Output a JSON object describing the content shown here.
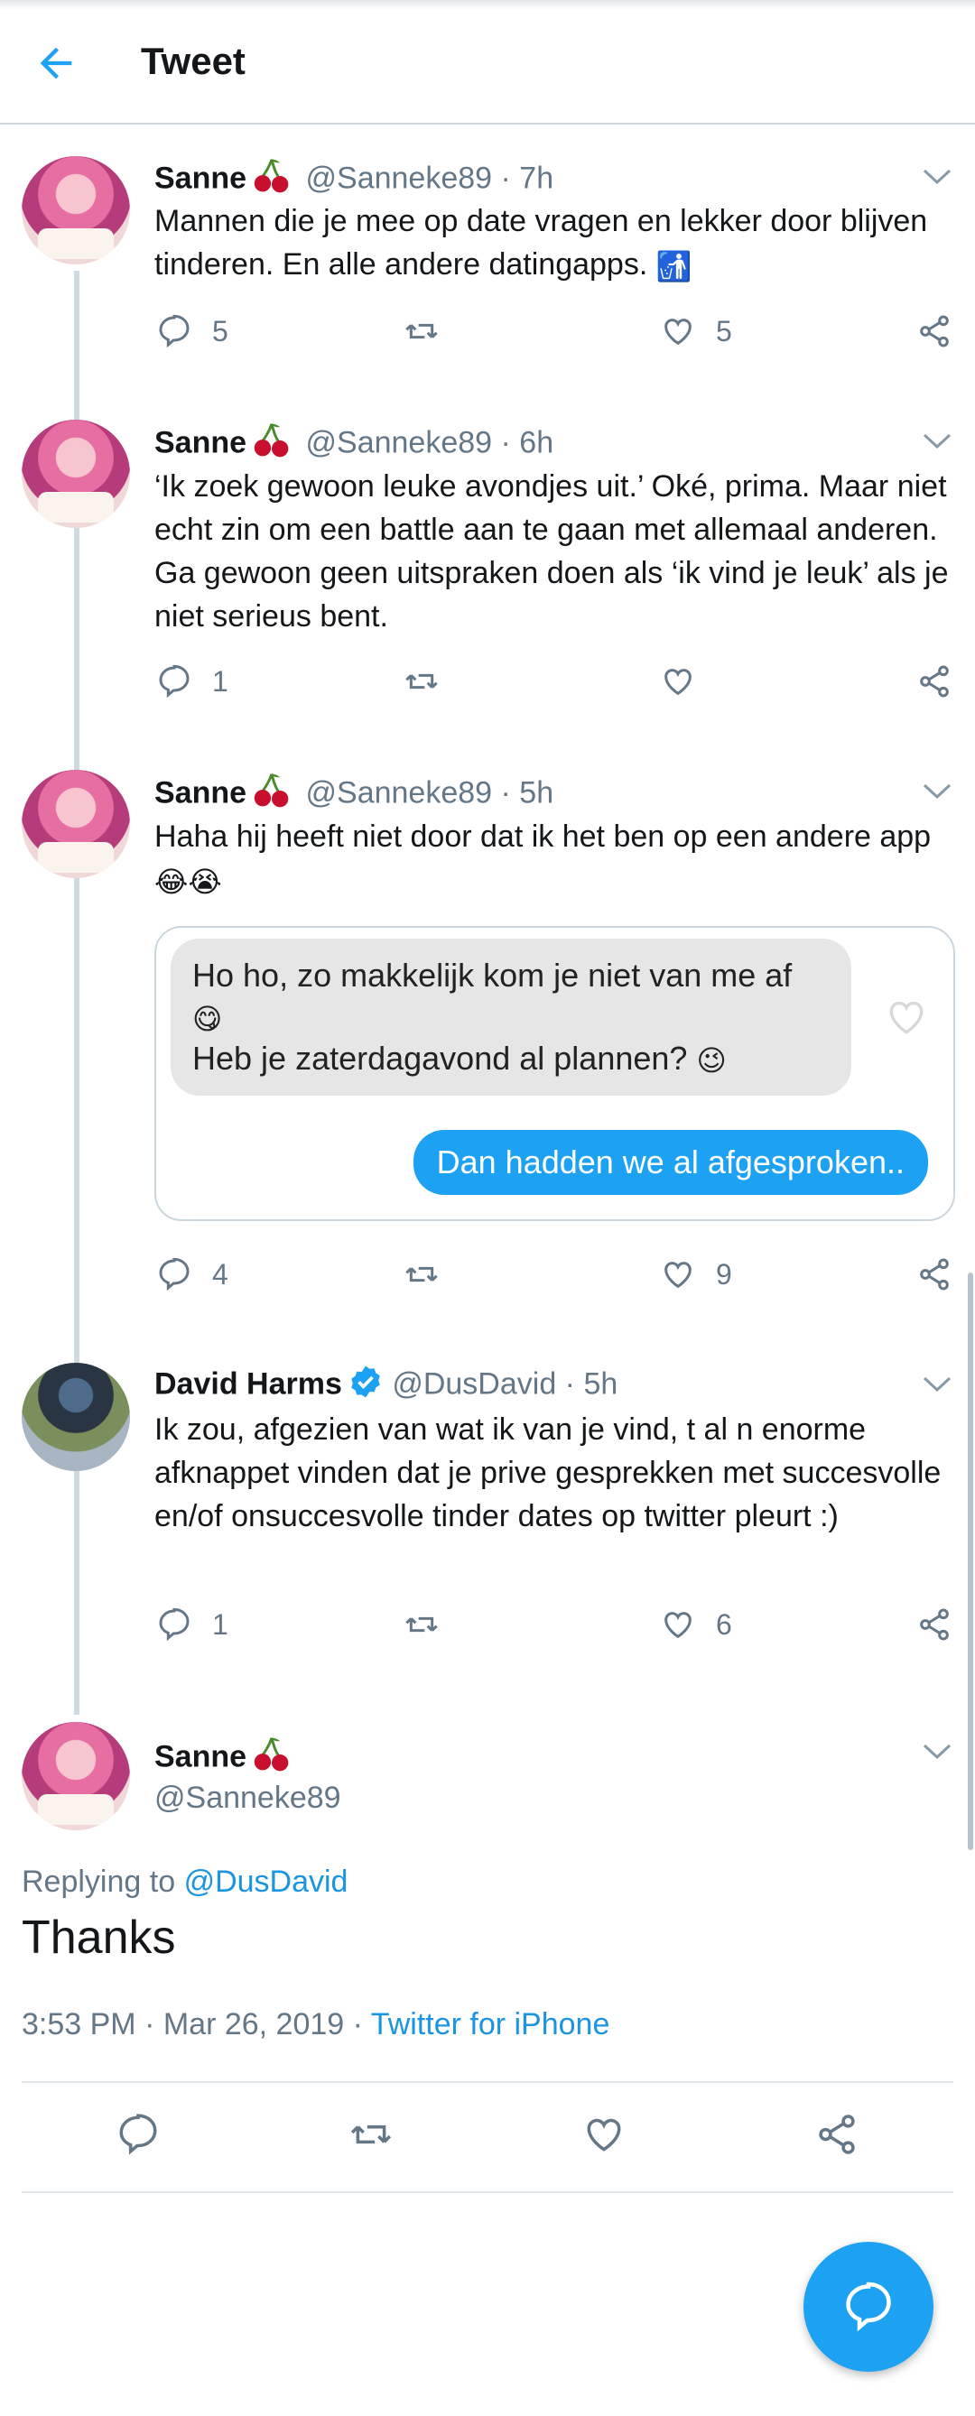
{
  "header": {
    "title": "Tweet",
    "back_icon": "back-arrow-icon"
  },
  "colors": {
    "accent": "#1da1f2",
    "link": "#1b95e0",
    "muted": "#657786",
    "text": "#14171a"
  },
  "thread": [
    {
      "name": "Sanne",
      "handle": "@Sanneke89",
      "time": "7h",
      "text": "Mannen die je mee op date vragen en lekker door blijven tinderen. En alle andere datingapps.",
      "emoji": "🚮",
      "replies": "5",
      "retweets": "",
      "likes": "5"
    },
    {
      "name": "Sanne",
      "handle": "@Sanneke89",
      "time": "6h",
      "text": "‘Ik zoek gewoon leuke avondjes uit.’ Oké, prima. Maar niet echt zin om een battle aan te gaan met allemaal anderen. Ga gewoon geen uitspraken doen als ‘ik vind je leuk’ als je niet serieus bent.",
      "replies": "1",
      "retweets": "",
      "likes": ""
    },
    {
      "name": "Sanne",
      "handle": "@Sanneke89",
      "time": "5h",
      "text": "Haha hij heeft niet door dat ik het ben op een andere app",
      "emoji": "😂😭",
      "media": {
        "incoming_line1": "Ho ho, zo makkelijk kom je niet van me af",
        "incoming_emoji1": "😋",
        "incoming_line2": "Heb je zaterdagavond al plannen?",
        "incoming_emoji2": "😉",
        "outgoing": "Dan hadden we al afgesproken.."
      },
      "replies": "4",
      "retweets": "",
      "likes": "9"
    },
    {
      "name": "David Harms",
      "handle": "@DusDavid",
      "time": "5h",
      "verified": true,
      "text": "Ik zou, afgezien van wat ik van je vind, t al n enorme afknappet vinden dat je prive gesprekken met succesvolle en/of onsuccesvolle tinder dates op twitter pleurt :)",
      "replies": "1",
      "retweets": "",
      "likes": "6"
    }
  ],
  "main": {
    "name": "Sanne",
    "handle": "@Sanneke89",
    "replying_prefix": "Replying to",
    "replying_handle": "@DusDavid",
    "text": "Thanks",
    "timestamp": "3:53 PM · Mar 26, 2019 · ",
    "source": "Twitter for iPhone"
  },
  "fab_icon": "compose-reply-icon"
}
